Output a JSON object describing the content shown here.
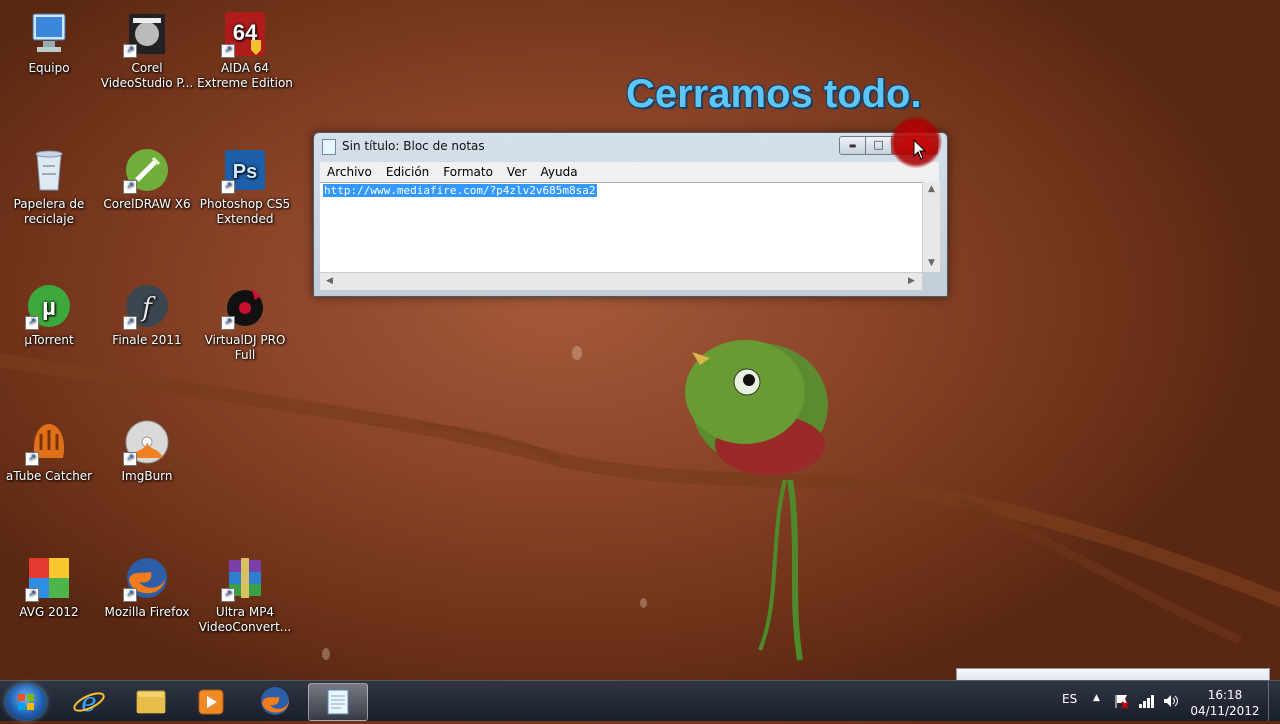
{
  "desktop": {
    "icons": [
      {
        "label": "Equipo",
        "icon": "computer-icon"
      },
      {
        "label": "Corel VideoStudio P...",
        "icon": "corel-videostudio-icon"
      },
      {
        "label": "AIDA 64 Extreme Edition",
        "icon": "aida64-icon"
      },
      {
        "label": "Papelera de reciclaje",
        "icon": "recycle-bin-icon"
      },
      {
        "label": "CorelDRAW X6",
        "icon": "coreldraw-icon"
      },
      {
        "label": "Photoshop CS5 Extended",
        "icon": "photoshop-icon"
      },
      {
        "label": "µTorrent",
        "icon": "utorrent-icon"
      },
      {
        "label": "Finale 2011",
        "icon": "finale-icon"
      },
      {
        "label": "VirtualDJ PRO Full",
        "icon": "virtualdj-icon"
      },
      {
        "label": "aTube Catcher",
        "icon": "atube-catcher-icon"
      },
      {
        "label": "ImgBurn",
        "icon": "imgburn-icon"
      },
      {
        "label": "AVG 2012",
        "icon": "avg-icon"
      },
      {
        "label": "Mozilla Firefox",
        "icon": "firefox-icon"
      },
      {
        "label": "Ultra MP4 VideoConvert...",
        "icon": "winrar-archive-icon"
      }
    ]
  },
  "overlay": {
    "caption": "Cerramos todo."
  },
  "notepad": {
    "title": "Sin título: Bloc de notas",
    "menu": [
      "Archivo",
      "Edición",
      "Formato",
      "Ver",
      "Ayuda"
    ],
    "content": "http://www.mediafire.com/?p4zlv2v685m8sa2",
    "minimize": "▬",
    "maximize": "□",
    "close": "✕"
  },
  "taskbar": {
    "language": "ES",
    "time": "16:18",
    "date": "04/11/2012",
    "items": [
      "windows-start-icon",
      "internet-explorer-icon",
      "windows-explorer-icon",
      "media-player-icon",
      "firefox-icon",
      "notepad-icon"
    ]
  },
  "colors": {
    "accent": "#3399ff",
    "caption": "#5ec6f2",
    "close_highlight": "#c80000"
  }
}
